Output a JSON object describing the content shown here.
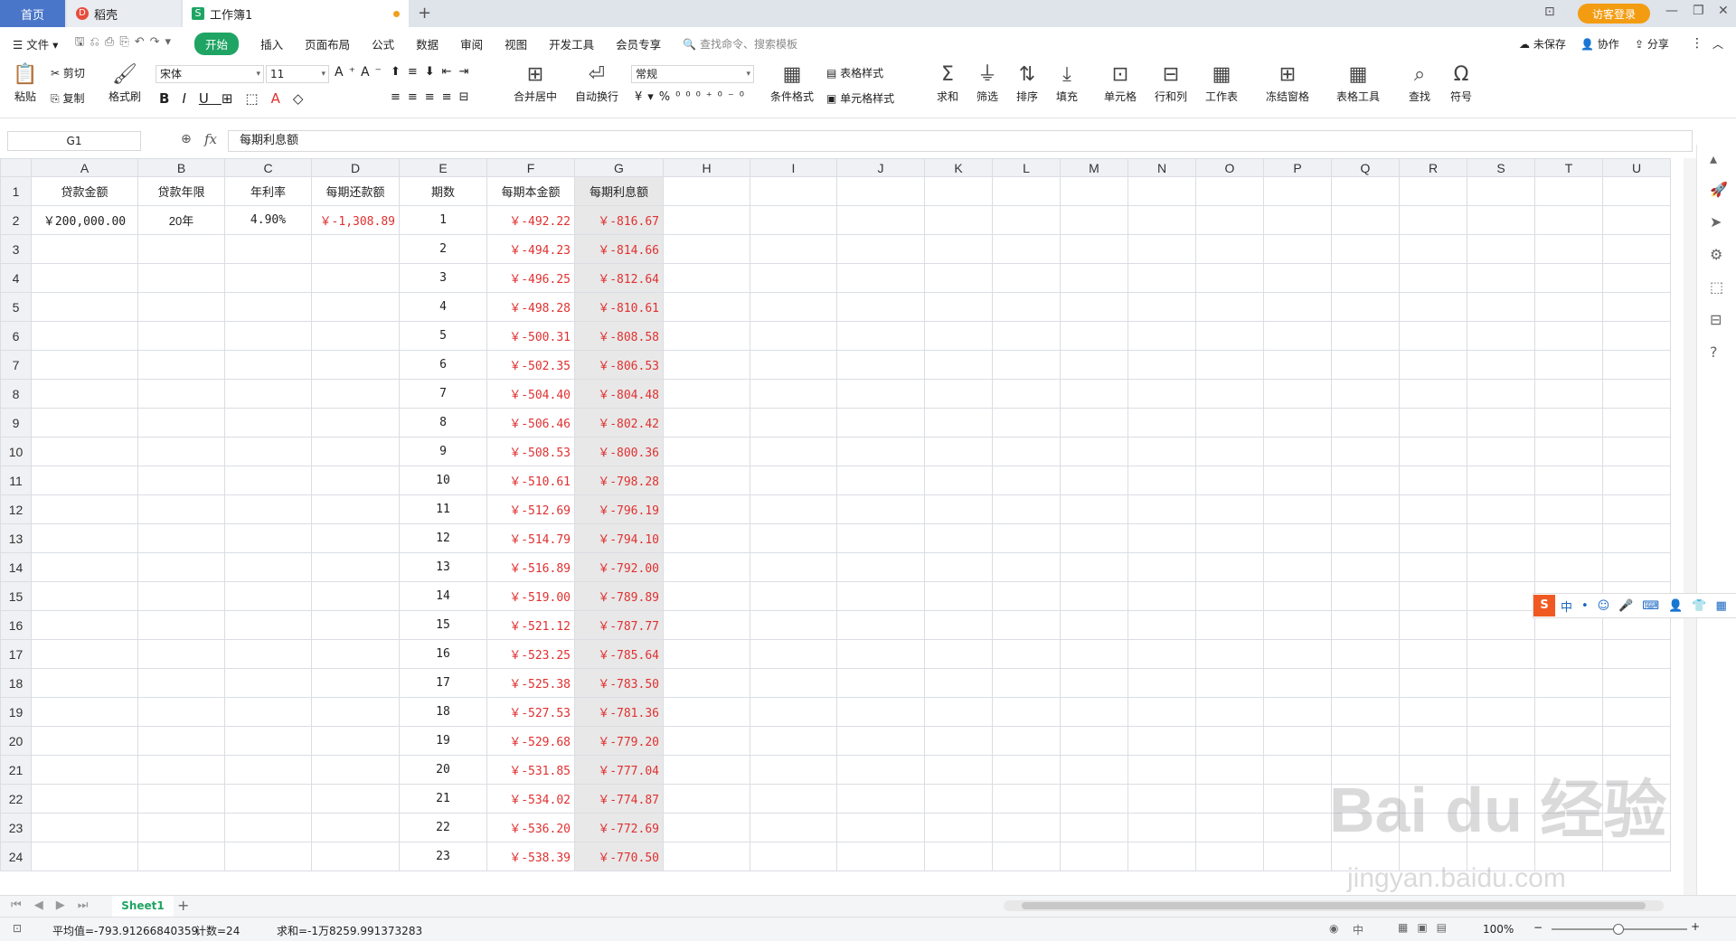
{
  "tabs": {
    "home": "首页",
    "doc": "稻壳",
    "book": "工作簿1",
    "login": "访客登录"
  },
  "menu": {
    "file": "文件",
    "items": [
      "开始",
      "插入",
      "页面布局",
      "公式",
      "数据",
      "审阅",
      "视图",
      "开发工具",
      "会员专享"
    ],
    "search_placeholder": "查找命令、搜索模板",
    "unsaved": "未保存",
    "collab": "协作",
    "share": "分享"
  },
  "ribbon": {
    "paste": "粘贴",
    "cut": "剪切",
    "copy": "复制",
    "format_painter": "格式刷",
    "font": "宋体",
    "font_size": "11",
    "merge_center": "合并居中",
    "auto_wrap": "自动换行",
    "number_format": "常规",
    "cond_format": "条件格式",
    "table_style": "表格样式",
    "cell_style": "单元格样式",
    "sum": "求和",
    "filter": "筛选",
    "sort": "排序",
    "fill": "填充",
    "cell": "单元格",
    "row_col": "行和列",
    "worksheet": "工作表",
    "freeze": "冻结窗格",
    "table_tools": "表格工具",
    "find": "查找",
    "symbol": "符号"
  },
  "formula_bar": {
    "cell_ref": "G1",
    "fx": "fx",
    "content": "每期利息额"
  },
  "columns": [
    "A",
    "B",
    "C",
    "D",
    "E",
    "F",
    "G",
    "H",
    "I",
    "J",
    "K",
    "L",
    "M",
    "N",
    "O",
    "P",
    "Q",
    "R",
    "S",
    "T",
    "U"
  ],
  "headers": [
    "贷款金额",
    "贷款年限",
    "年利率",
    "每期还款额",
    "期数",
    "每期本金额",
    "每期利息额"
  ],
  "row2": {
    "loan": "￥200,000.00",
    "years": "20年",
    "rate": "4.90%",
    "payment": "￥-1,308.89"
  },
  "rows": [
    {
      "n": "1",
      "p": "￥-492.22",
      "i": "￥-816.67"
    },
    {
      "n": "2",
      "p": "￥-494.23",
      "i": "￥-814.66"
    },
    {
      "n": "3",
      "p": "￥-496.25",
      "i": "￥-812.64"
    },
    {
      "n": "4",
      "p": "￥-498.28",
      "i": "￥-810.61"
    },
    {
      "n": "5",
      "p": "￥-500.31",
      "i": "￥-808.58"
    },
    {
      "n": "6",
      "p": "￥-502.35",
      "i": "￥-806.53"
    },
    {
      "n": "7",
      "p": "￥-504.40",
      "i": "￥-804.48"
    },
    {
      "n": "8",
      "p": "￥-506.46",
      "i": "￥-802.42"
    },
    {
      "n": "9",
      "p": "￥-508.53",
      "i": "￥-800.36"
    },
    {
      "n": "10",
      "p": "￥-510.61",
      "i": "￥-798.28"
    },
    {
      "n": "11",
      "p": "￥-512.69",
      "i": "￥-796.19"
    },
    {
      "n": "12",
      "p": "￥-514.79",
      "i": "￥-794.10"
    },
    {
      "n": "13",
      "p": "￥-516.89",
      "i": "￥-792.00"
    },
    {
      "n": "14",
      "p": "￥-519.00",
      "i": "￥-789.89"
    },
    {
      "n": "15",
      "p": "￥-521.12",
      "i": "￥-787.77"
    },
    {
      "n": "16",
      "p": "￥-523.25",
      "i": "￥-785.64"
    },
    {
      "n": "17",
      "p": "￥-525.38",
      "i": "￥-783.50"
    },
    {
      "n": "18",
      "p": "￥-527.53",
      "i": "￥-781.36"
    },
    {
      "n": "19",
      "p": "￥-529.68",
      "i": "￥-779.20"
    },
    {
      "n": "20",
      "p": "￥-531.85",
      "i": "￥-777.04"
    },
    {
      "n": "21",
      "p": "￥-534.02",
      "i": "￥-774.87"
    },
    {
      "n": "22",
      "p": "￥-536.20",
      "i": "￥-772.69"
    },
    {
      "n": "23",
      "p": "￥-538.39",
      "i": "￥-770.50"
    }
  ],
  "sheet_tab": "Sheet1",
  "status": {
    "average": "平均值=-793.91266840359",
    "count": "计数=24",
    "sum": "求和=-1万8259.991373283",
    "zoom": "100%",
    "ime_lang": "中"
  },
  "watermark": {
    "brand": "Bai du 经验",
    "url": "jingyan.baidu.com"
  },
  "colors": {
    "accent": "#1fa463",
    "negative": "#e03030",
    "login": "#f39c12"
  }
}
